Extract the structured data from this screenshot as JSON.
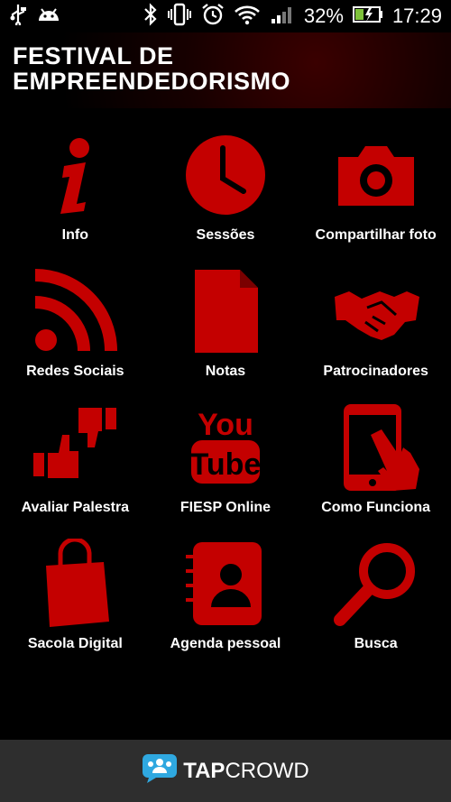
{
  "status_bar": {
    "battery_percent": "32%",
    "time": "17:29",
    "icons": [
      "usb-icon",
      "android-icon",
      "bluetooth-icon",
      "vibrate-icon",
      "alarm-icon",
      "wifi-icon",
      "signal-icon",
      "battery-icon"
    ]
  },
  "header": {
    "title_line1": "FESTIVAL DE",
    "title_line2": "EMPREENDEDORISMO"
  },
  "menu": {
    "info": "Info",
    "sessoes": "Sessões",
    "compartilhar": "Compartilhar foto",
    "redes": "Redes Sociais",
    "notas": "Notas",
    "patrocinadores": "Patrocinadores",
    "avaliar": "Avaliar Palestra",
    "fiesp": "FIESP Online",
    "como": "Como Funciona",
    "sacola": "Sacola Digital",
    "agenda": "Agenda pessoal",
    "busca": "Busca"
  },
  "footer": {
    "brand_part1": "TAP",
    "brand_part2": "CROWD"
  },
  "colors": {
    "accent": "#c40000",
    "background": "#000000",
    "footer": "#2e2e2e"
  }
}
